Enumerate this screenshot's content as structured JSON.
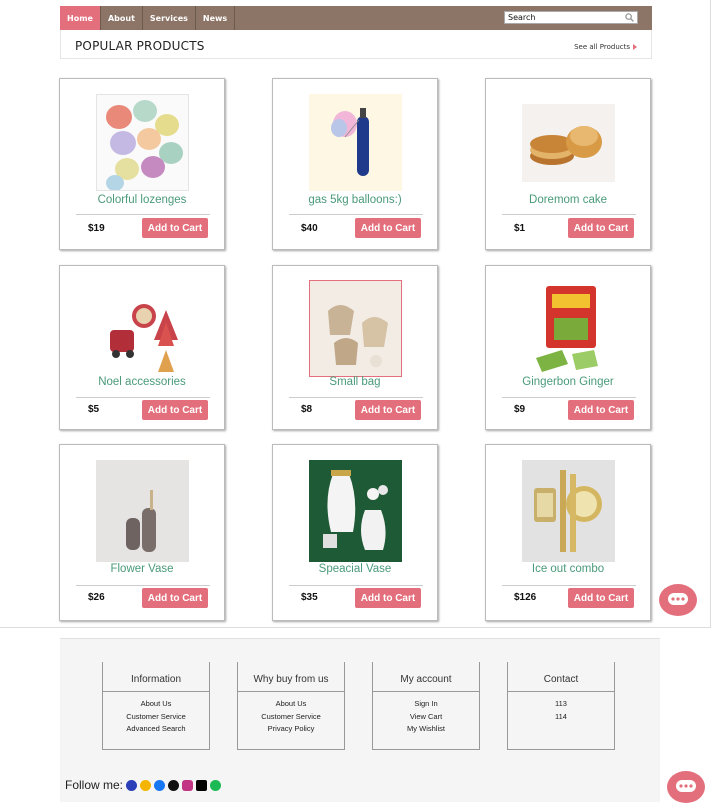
{
  "nav": {
    "items": [
      {
        "label": "Home",
        "active": true
      },
      {
        "label": "About",
        "active": false
      },
      {
        "label": "Services",
        "active": false
      },
      {
        "label": "News",
        "active": false
      }
    ],
    "search_placeholder": "Search"
  },
  "section": {
    "title": "POPULAR PRODUCTS",
    "see_all": "See all Products"
  },
  "products": [
    {
      "name": "Colorful lozenges",
      "price": "$19",
      "button": "Add to Cart"
    },
    {
      "name": "gas 5kg balloons:)",
      "price": "$40",
      "button": "Add to Cart"
    },
    {
      "name": "Doremom cake",
      "price": "$1",
      "button": "Add to Cart"
    },
    {
      "name": "Noel accessories",
      "price": "$5",
      "button": "Add to Cart"
    },
    {
      "name": "Small bag",
      "price": "$8",
      "button": "Add to Cart"
    },
    {
      "name": "Gingerbon Ginger",
      "price": "$9",
      "button": "Add to Cart"
    },
    {
      "name": "Flower Vase",
      "price": "$26",
      "button": "Add to Cart"
    },
    {
      "name": "Speacial Vase",
      "price": "$35",
      "button": "Add to Cart"
    },
    {
      "name": "Ice out combo",
      "price": "$126",
      "button": "Add to Cart"
    }
  ],
  "footer": {
    "columns": [
      {
        "title": "Information",
        "links": [
          "About Us",
          "Customer Service",
          "Advanced Search"
        ]
      },
      {
        "title": "Why buy from us",
        "links": [
          "About Us",
          "Customer Service",
          "Privacy Policy"
        ]
      },
      {
        "title": "My account",
        "links": [
          "Sign In",
          "View Cart",
          "My Wishlist"
        ]
      },
      {
        "title": "Contact",
        "links": [
          "113",
          "114"
        ]
      }
    ],
    "follow_label": "Follow me:",
    "social_icons": [
      "messenger-icon",
      "coin-icon",
      "facebook-icon",
      "github-icon",
      "instagram-icon",
      "tiktok-icon",
      "spotify-icon"
    ]
  },
  "colors": {
    "accent": "#e46f7c",
    "nav_bg": "#8c7466",
    "product_name": "#4a9a7a"
  }
}
